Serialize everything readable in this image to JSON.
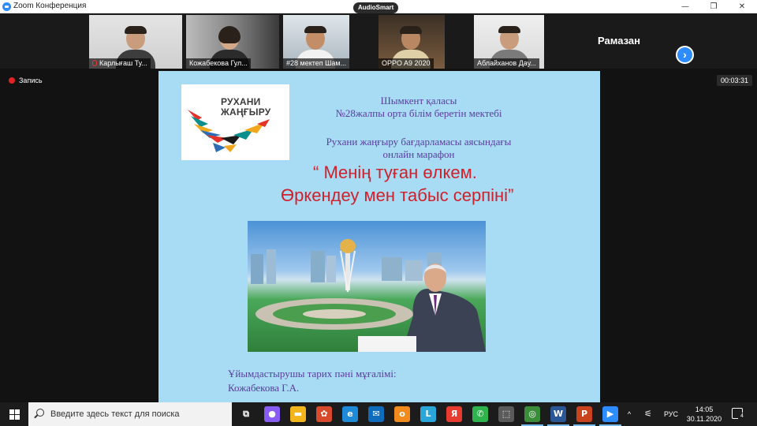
{
  "window": {
    "title": "Zoom Конференция",
    "minimize_glyph": "—",
    "maximize_glyph": "❐",
    "close_glyph": "✕"
  },
  "audio_indicator": "AudioSmart",
  "participants": [
    {
      "name": "Карлығаш Ту...",
      "muted": true
    },
    {
      "name": "Кожабекова Гул...",
      "muted": false,
      "active": true
    },
    {
      "name": "#28 мектеп Шам..."
    },
    {
      "name": "OPPO A9 2020"
    },
    {
      "name": "Аблайханов Дау..."
    }
  ],
  "name_only_participant": "Рамазан",
  "next_page_glyph": "›",
  "recording_label": "Запись",
  "meeting_timer": "00:03:31",
  "slide": {
    "logo_line1": "РУХАНИ",
    "logo_line2": "ЖАҢҒЫРУ",
    "city": "Шымкент қаласы",
    "school": "№28жалпы орта білім беретін мектебі",
    "program_line1": "Рухани жаңғыру бағдарламасы аясындағы",
    "program_line2": "онлайн марафон",
    "title_line1": "“ Менің туған өлкем.",
    "title_line2": "Өркендеу мен табыс серпіні”",
    "organizer_line1": "Ұйымдастырушы тарих пәні мұғалімі:",
    "organizer_line2": "Кожабекова Г.А."
  },
  "taskbar": {
    "search_placeholder": "Введите здесь текст для поиска",
    "apps": [
      {
        "name": "task-view",
        "label": "⧉",
        "color": "#1c1c1c"
      },
      {
        "name": "alice",
        "label": "●",
        "color": "#8a5cf6"
      },
      {
        "name": "file-explorer",
        "label": "▬",
        "color": "#f2b61c"
      },
      {
        "name": "game",
        "label": "✿",
        "color": "#d84a2c"
      },
      {
        "name": "edge",
        "label": "e",
        "color": "#1f8ad8"
      },
      {
        "name": "mail",
        "label": "✉",
        "color": "#0f6cbd"
      },
      {
        "name": "odnoklassniki",
        "label": "o",
        "color": "#f38a1e"
      },
      {
        "name": "launcher-l",
        "label": "L",
        "color": "#2ba6d9"
      },
      {
        "name": "yandex",
        "label": "Я",
        "color": "#e63b2e"
      },
      {
        "name": "whatsapp",
        "label": "✆",
        "color": "#2fb34c"
      },
      {
        "name": "store",
        "label": "⬚",
        "color": "#5a5a5a"
      },
      {
        "name": "chrome",
        "label": "◎",
        "color": "#3b8d3a"
      },
      {
        "name": "word",
        "label": "W",
        "color": "#2b5797"
      },
      {
        "name": "powerpoint",
        "label": "P",
        "color": "#c9431e"
      },
      {
        "name": "zoom",
        "label": "▶",
        "color": "#2d8cff"
      }
    ],
    "tray_up_glyph": "^",
    "tray_network_glyph": "⚟",
    "language": "РУС",
    "time": "14:05",
    "date": "30.11.2020",
    "notification_count": "4"
  },
  "colors": {
    "zoom_blue": "#2d8cff",
    "active_speaker": "#36c33b",
    "slide_bg": "#a8dcf4",
    "slide_text": "#5b3a9e",
    "slide_title": "#d0202a",
    "recording": "#e02424"
  }
}
